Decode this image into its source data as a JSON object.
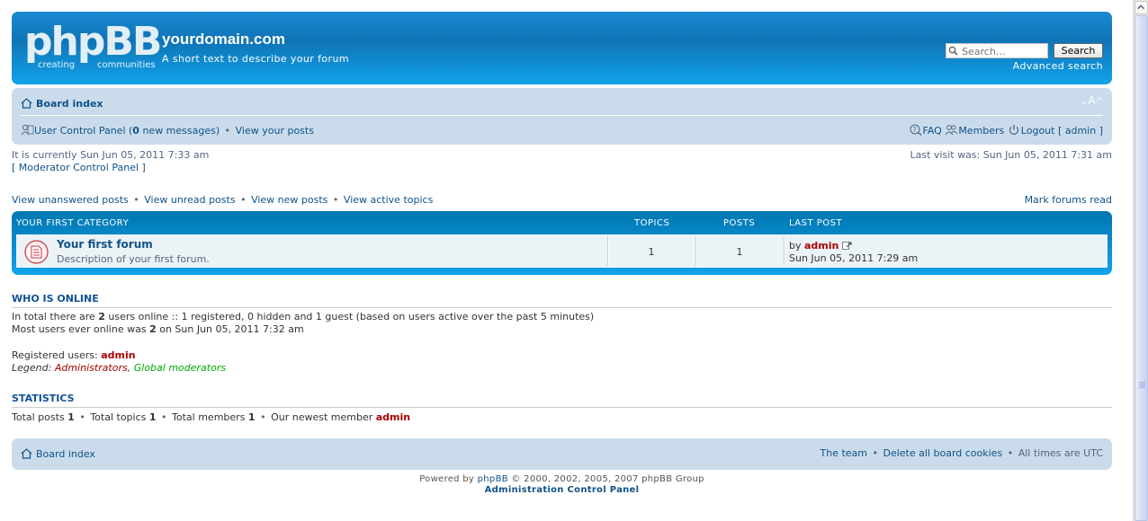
{
  "header": {
    "logo_text": "phpBB",
    "logo_tagline_1": "creating",
    "logo_tagline_2": "communities",
    "site_title": "yourdomain.com",
    "site_description": "A short text to describe your forum",
    "search_placeholder": "Search…",
    "search_button": "Search",
    "advanced_search": "Advanced search"
  },
  "navbar": {
    "breadcrumb": "Board index",
    "font_resize": "A",
    "ucp_label": "User Control Panel (",
    "new_messages_count": "0",
    "new_messages_label": " new messages)",
    "view_posts": "View your posts",
    "faq": "FAQ",
    "members": "Members",
    "logout": "Logout [ admin ]"
  },
  "info": {
    "current_time": "It is currently Sun Jun 05, 2011 7:33 am",
    "mcp": "[ Moderator Control Panel ]",
    "last_visit": "Last visit was: Sun Jun 05, 2011 7:31 am"
  },
  "links": {
    "unanswered": "View unanswered posts",
    "unread": "View unread posts",
    "new_posts": "View new posts",
    "active_topics": "View active topics",
    "mark_read": "Mark forums read"
  },
  "category": {
    "name": "Your first category",
    "col_topics": "Topics",
    "col_posts": "Posts",
    "col_last_post": "Last post",
    "forums": [
      {
        "title": "Your first forum",
        "description": "Description of your first forum.",
        "topics": "1",
        "posts": "1",
        "last_post_by_prefix": "by",
        "last_post_by": "admin",
        "last_post_time": "Sun Jun 05, 2011 7:29 am"
      }
    ]
  },
  "who_online": {
    "heading": "Who is online",
    "line1_a": "In total there are ",
    "line1_count": "2",
    "line1_b": " users online :: 1 registered, 0 hidden and 1 guest (based on users active over the past 5 minutes)",
    "line2_a": "Most users ever online was ",
    "line2_count": "2",
    "line2_b": " on Sun Jun 05, 2011 7:32 am",
    "registered_label": "Registered users: ",
    "registered_user": "admin",
    "legend_label": "Legend: ",
    "legend_admins": "Administrators",
    "legend_mods": "Global moderators"
  },
  "statistics": {
    "heading": "Statistics",
    "total_posts_label": "Total posts ",
    "total_posts": "1",
    "total_topics_label": "Total topics ",
    "total_topics": "1",
    "total_members_label": "Total members ",
    "total_members": "1",
    "newest_label": "Our newest member ",
    "newest_member": "admin"
  },
  "footer": {
    "breadcrumb": "Board index",
    "team": "The team",
    "delete_cookies": "Delete all board cookies",
    "timezone": "All times are UTC",
    "powered_prefix": "Powered by ",
    "powered_link": "phpBB",
    "powered_suffix": " © 2000, 2002, 2005, 2007 phpBB Group",
    "acp": "Administration Control Panel"
  },
  "colors": {
    "header_blue": "#0f74b6",
    "navbar_bg": "#cadceb",
    "link": "#105289",
    "admin_red": "#aa0000",
    "moderator_green": "#00aa00"
  }
}
